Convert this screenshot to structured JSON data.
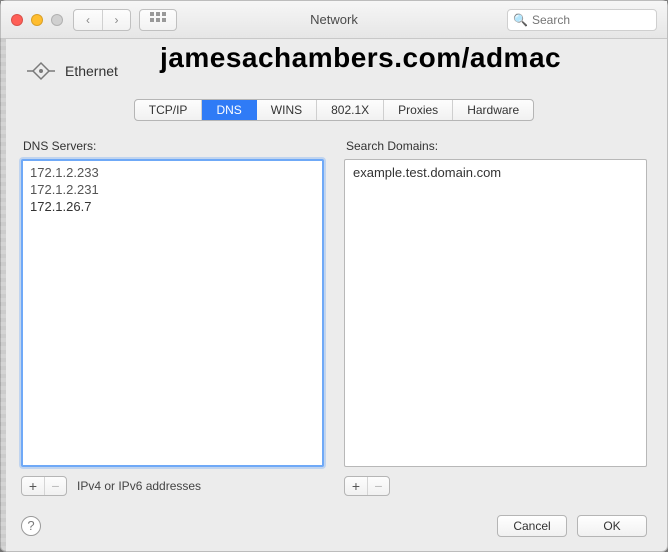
{
  "window": {
    "title": "Network"
  },
  "toolbar": {
    "search_placeholder": "Search"
  },
  "overlay": {
    "banner": "jamesachambers.com/admac"
  },
  "connection": {
    "name": "Ethernet"
  },
  "tabs": {
    "items": [
      "TCP/IP",
      "DNS",
      "WINS",
      "802.1X",
      "Proxies",
      "Hardware"
    ],
    "active": "DNS"
  },
  "dns": {
    "servers_label": "DNS Servers:",
    "servers": [
      "172.1.2.233",
      "172.1.2.231",
      "172.1.26.7"
    ],
    "hint": "IPv4 or IPv6 addresses",
    "domains_label": "Search Domains:",
    "domains": [
      "example.test.domain.com"
    ]
  },
  "buttons": {
    "add": "+",
    "remove": "−",
    "cancel": "Cancel",
    "ok": "OK",
    "help": "?"
  }
}
